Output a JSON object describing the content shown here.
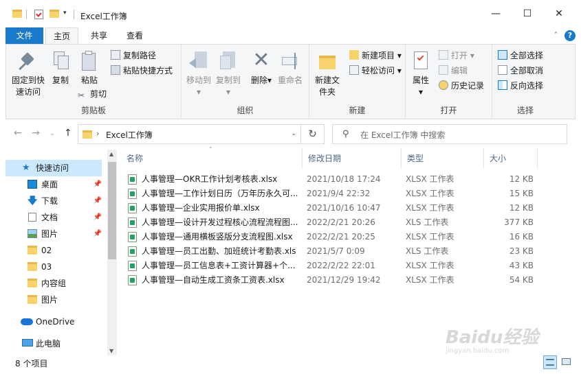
{
  "window": {
    "title": "Excel工作簿",
    "controls": {
      "minimize": "—",
      "maximize": "☐",
      "close": "✕"
    }
  },
  "tabs": {
    "file": "文件",
    "home": "主页",
    "share": "共享",
    "view": "查看"
  },
  "ribbon": {
    "clipboard": {
      "label": "剪贴板",
      "pin": "固定到快速访问",
      "copy": "复制",
      "paste": "粘贴",
      "copy_path": "复制路径",
      "paste_shortcut": "粘贴快捷方式",
      "cut": "剪切"
    },
    "organize": {
      "label": "组织",
      "move_to": "移动到",
      "copy_to": "复制到",
      "delete": "删除",
      "rename": "重命名"
    },
    "new": {
      "label": "新建",
      "new_folder": "新建文件夹",
      "new_item": "新建项目",
      "easy_access": "轻松访问"
    },
    "open": {
      "label": "打开",
      "properties": "属性",
      "open": "打开",
      "edit": "编辑",
      "history": "历史记录"
    },
    "select": {
      "label": "选择",
      "select_all": "全部选择",
      "select_none": "全部取消",
      "invert": "反向选择"
    }
  },
  "address": {
    "path": "Excel工作簿",
    "search_placeholder": "在 Excel工作簿 中搜索"
  },
  "navpane": {
    "items": [
      {
        "label": "快速访问",
        "icon": "star-icon",
        "pinned": false
      },
      {
        "label": "桌面",
        "icon": "desktop-icon",
        "pinned": true
      },
      {
        "label": "下载",
        "icon": "download-icon",
        "pinned": true
      },
      {
        "label": "文档",
        "icon": "document-icon",
        "pinned": true
      },
      {
        "label": "图片",
        "icon": "pictures-icon",
        "pinned": true
      },
      {
        "label": "02",
        "icon": "folder-icon",
        "pinned": false
      },
      {
        "label": "03",
        "icon": "folder-icon",
        "pinned": false
      },
      {
        "label": "内容组",
        "icon": "folder-icon",
        "pinned": false
      },
      {
        "label": "图片",
        "icon": "folder-icon",
        "pinned": false
      },
      {
        "label": "OneDrive",
        "icon": "cloud-icon",
        "pinned": false
      },
      {
        "label": "此电脑",
        "icon": "computer-icon",
        "pinned": false
      }
    ]
  },
  "columns": {
    "name": "名称",
    "date": "修改日期",
    "type": "类型",
    "size": "大小"
  },
  "files": [
    {
      "name": "人事管理—OKR工作计划考核表.xlsx",
      "date": "2021/10/18 17:24",
      "type": "XLSX 工作表",
      "size": "12 KB"
    },
    {
      "name": "人事管理—工作计划日历（万年历永久可...",
      "date": "2021/9/4 22:32",
      "type": "XLSX 工作表",
      "size": "15 KB"
    },
    {
      "name": "人事管理—企业实用报价单.xlsx",
      "date": "2021/10/16 10:47",
      "type": "XLSX 工作表",
      "size": "12 KB"
    },
    {
      "name": "人事管理—设计开发过程核心流程流程图...",
      "date": "2022/2/21 20:26",
      "type": "XLS 工作表",
      "size": "377 KB"
    },
    {
      "name": "人事管理—通用横板竖版分支流程图.xlsx",
      "date": "2022/2/21 20:25",
      "type": "XLSX 工作表",
      "size": "16 KB"
    },
    {
      "name": "人事管理—员工出勤、加班统计考勤表.xls",
      "date": "2021/5/7 0:09",
      "type": "XLS 工作表",
      "size": "23 KB"
    },
    {
      "name": "人事管理—员工信息表+工资计算器+个...",
      "date": "2022/2/22 22:01",
      "type": "XLSX 工作表",
      "size": "43 KB"
    },
    {
      "name": "人事管理—自动生成工资条工资表.xlsx",
      "date": "2021/12/29 19:42",
      "type": "XLSX 工作表",
      "size": "54 KB"
    }
  ],
  "status": {
    "count": "8 个项目"
  },
  "watermark": {
    "logo": "Baidu经验",
    "url": "jingyan.baidu.com"
  },
  "colors": {
    "accent": "#1979ca",
    "selected": "#cce8ff",
    "excel_green": "#21a366",
    "folder": "#f8d26a"
  }
}
